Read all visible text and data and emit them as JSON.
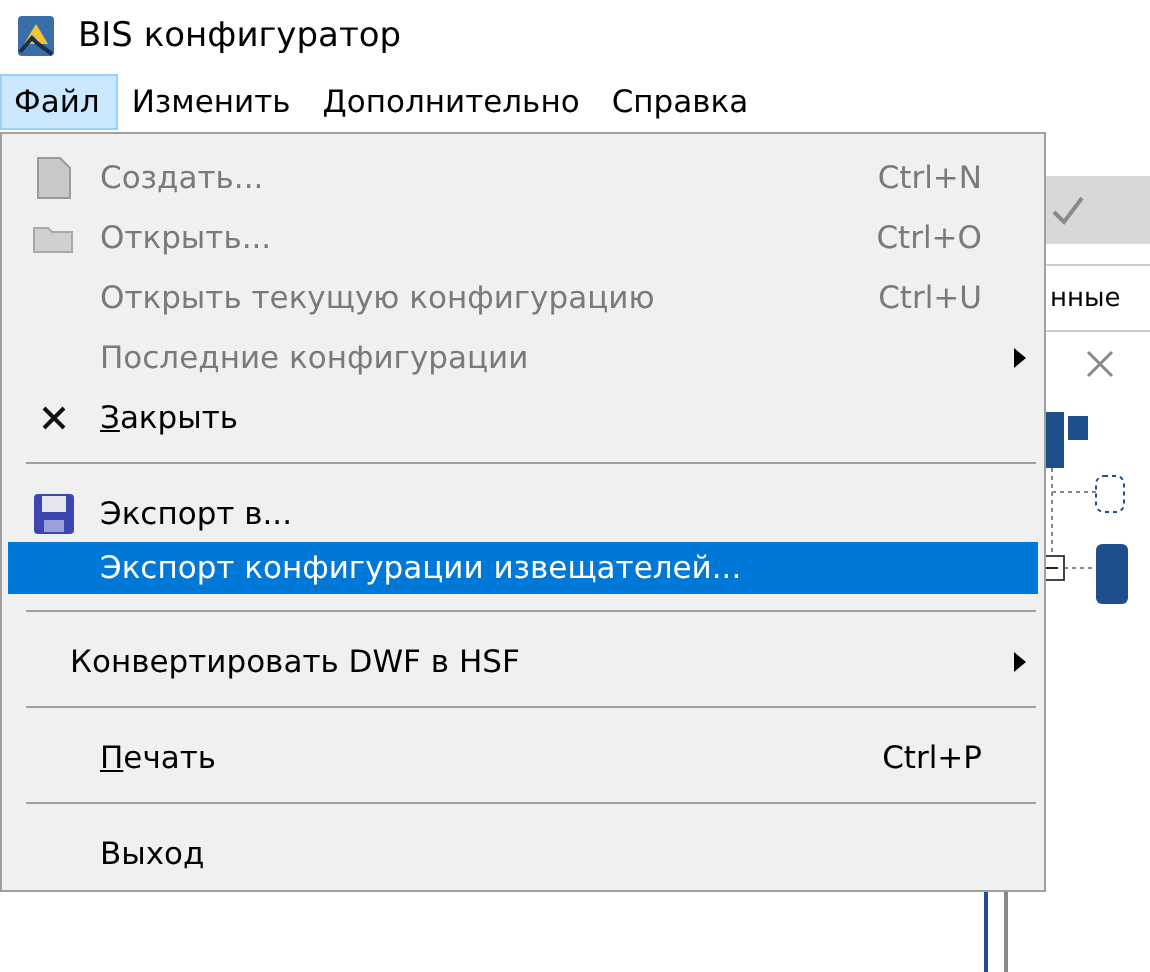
{
  "window": {
    "title": "BIS конфигуратор"
  },
  "menu_bar": [
    {
      "label": "Файл",
      "selected": true
    },
    {
      "label": "Изменить",
      "selected": false
    },
    {
      "label": "Дополнительно",
      "selected": false
    },
    {
      "label": "Справка",
      "selected": false
    }
  ],
  "file_menu": [
    {
      "kind": "document-item",
      "label": "Создать...",
      "shortcut": "Ctrl+N",
      "disabled": true,
      "selected": false
    },
    {
      "kind": "folder-item",
      "label": "Открыть...",
      "shortcut": "Ctrl+O",
      "disabled": true,
      "selected": false
    },
    {
      "kind": "item",
      "label": "Открыть текущую конфигурацию",
      "shortcut": "Ctrl+U",
      "disabled": true,
      "selected": false
    },
    {
      "kind": "item",
      "label": "Последние конфигурации",
      "submenu": true,
      "disabled": true,
      "selected": false
    },
    {
      "kind": "close-item",
      "label": "Закрыть",
      "mnemonic": true,
      "disabled": false,
      "selected": false
    },
    {
      "kind": "separator"
    },
    {
      "kind": "save-item",
      "label": "Экспорт в...",
      "disabled": false,
      "selected": false
    },
    {
      "kind": "item",
      "label": "Экспорт конфигурации извещателей...",
      "disabled": false,
      "selected": true
    },
    {
      "kind": "separator"
    },
    {
      "kind": "wide-item",
      "label": "Конвертировать DWF в HSF",
      "submenu": true,
      "disabled": false,
      "selected": false
    },
    {
      "kind": "separator"
    },
    {
      "kind": "item",
      "label": "Печать",
      "shortcut": "Ctrl+P",
      "mnemonic": true,
      "disabled": false,
      "selected": false
    },
    {
      "kind": "separator"
    },
    {
      "kind": "item",
      "label": "Выход",
      "disabled": false,
      "selected": false
    }
  ],
  "background_panel": {
    "partial_label": "нные"
  }
}
